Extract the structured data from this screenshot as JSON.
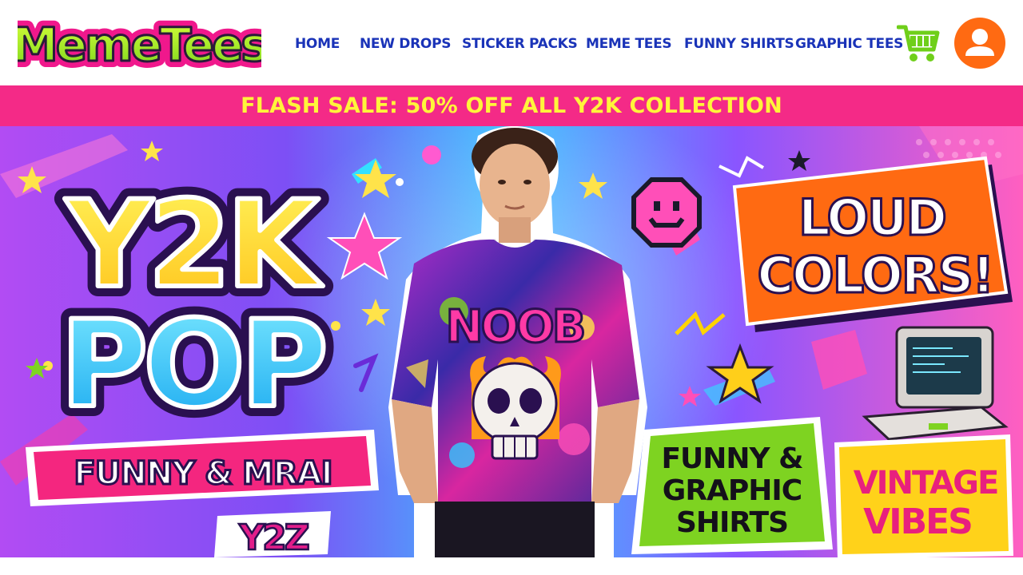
{
  "brand": {
    "name": "MemeTees"
  },
  "nav": {
    "items": [
      {
        "label": "HOME"
      },
      {
        "label": "NEW DROPS"
      },
      {
        "label": "STICKER PACKS"
      },
      {
        "label": "MEME TEES"
      },
      {
        "label": "FUNNY SHIRTS"
      },
      {
        "label": "GRAPHIC TEES"
      }
    ]
  },
  "header_icons": {
    "cart": "shopping-cart-icon",
    "user": "user-account-icon"
  },
  "flash_bar": {
    "text": "FLASH SALE: 50% OFF ALL Y2K COLLECTION"
  },
  "hero": {
    "title_line1": "Y2K",
    "title_line2": "POP",
    "badge_left": "FUNNY & MRAI",
    "badge_loud_line1": "LOUD",
    "badge_loud_line2": "COLORS!",
    "shirt_text": "NOOB",
    "funny_graphic_lines": [
      "FUNNY &",
      "GRAPHIC",
      "SHIRTS"
    ],
    "vintage_lines": [
      "VINTAGE",
      "VIBES"
    ],
    "sticker_small": "Y2Z"
  },
  "colors": {
    "nav_text": "#1a33b8",
    "flash_bg": "#f42a87",
    "flash_text": "#fff53a",
    "accent_orange": "#ff6a12",
    "accent_green": "#7ed321",
    "hero_purple": "#8a3cf0",
    "hero_pink": "#ff4fb8",
    "hero_cyan": "#32c8ff"
  }
}
